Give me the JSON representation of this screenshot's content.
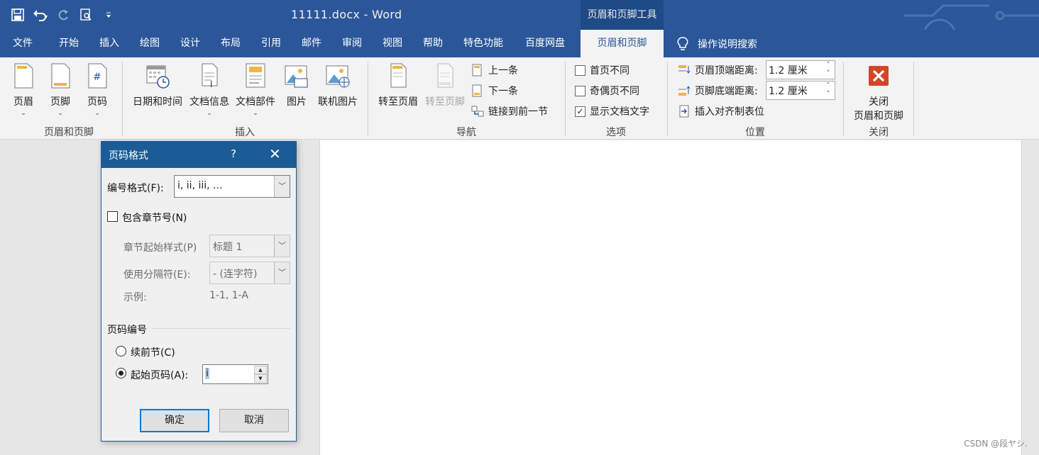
{
  "app": {
    "doc_title": "11111.docx  -  Word",
    "context_tool_header": "页眉和页脚工具",
    "qat": {
      "save_icon": "save-icon",
      "undo_icon": "undo-icon",
      "redo_icon": "redo-icon",
      "print_preview_icon": "print-preview-icon",
      "customize_icon": "customize-icon"
    }
  },
  "tabs": [
    "文件",
    "开始",
    "插入",
    "绘图",
    "设计",
    "布局",
    "引用",
    "邮件",
    "审阅",
    "视图",
    "帮助",
    "特色功能",
    "百度网盘",
    "页眉和页脚"
  ],
  "tell_me": "操作说明搜索",
  "ribbon": {
    "groups": {
      "header_footer": {
        "label": "页眉和页脚",
        "header": "页眉",
        "footer": "页脚",
        "page_number": "页码"
      },
      "insert": {
        "label": "插入",
        "date_time": "日期和时间",
        "doc_info": "文档信息",
        "quick_parts": "文档部件",
        "picture": "图片",
        "online_picture": "联机图片"
      },
      "navigation": {
        "label": "导航",
        "go_to_header": "转至页眉",
        "go_to_footer": "转至页脚",
        "previous": "上一条",
        "next": "下一条",
        "link_previous": "链接到前一节"
      },
      "options": {
        "label": "选项",
        "different_first": "首页不同",
        "different_odd_even": "奇偶页不同",
        "show_doc_text": "显示文档文字",
        "show_doc_text_checked": true
      },
      "position": {
        "label": "位置",
        "header_from_top": "页眉顶端距离:",
        "header_from_top_value": "1.2 厘米",
        "footer_from_bottom": "页脚底端距离:",
        "footer_from_bottom_value": "1.2 厘米",
        "insert_align_tab": "插入对齐制表位"
      },
      "close": {
        "label": "关闭",
        "close_line1": "关闭",
        "close_line2": "页眉和页脚"
      }
    }
  },
  "dialog": {
    "title": "页码格式",
    "help": "?",
    "close": "✕",
    "number_format_label": "编号格式(F):",
    "number_format_value": "i, ii, iii, ...",
    "include_chapter_label": "包含章节号(N)",
    "include_chapter_checked": false,
    "chapter_style_label": "章节起始样式(P)",
    "chapter_style_value": "标题 1",
    "separator_label": "使用分隔符(E):",
    "separator_value": "-  (连字符)",
    "example_label": "示例:",
    "example_value": "1-1, 1-A",
    "page_numbering_label": "页码编号",
    "continue_label": "续前节(C)",
    "start_at_label": "起始页码(A):",
    "start_at_value": "i",
    "ok": "确定",
    "cancel": "取消"
  },
  "watermark": "CSDN @段ヤシ."
}
